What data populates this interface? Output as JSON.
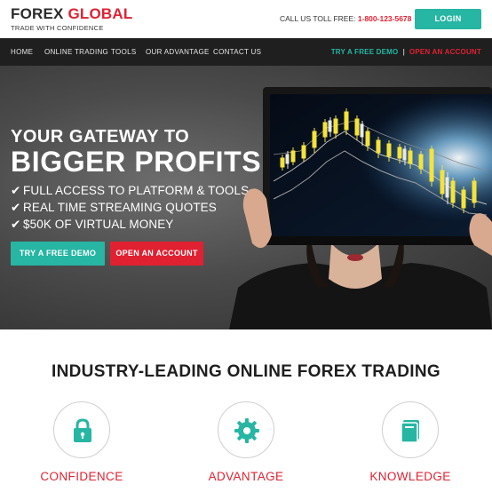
{
  "brand": {
    "name_part1": "FOREX",
    "name_part2": "GLOBAL",
    "tagline": "TRADE WITH CONFIDENCE",
    "colors": {
      "dark": "#2b2b2b",
      "red": "#e02131"
    }
  },
  "header": {
    "callus_label": "CALL US TOLL FREE:",
    "phone": "1-800-123-5678",
    "login_label": "LOGIN"
  },
  "nav": {
    "items": [
      {
        "label": "HOME"
      },
      {
        "label": "ONLINE TRADING"
      },
      {
        "label": "TOOLS"
      },
      {
        "label": "OUR ADVANTAGE"
      },
      {
        "label": "CONTACT US"
      }
    ],
    "try_demo": "TRY A FREE DEMO",
    "separator": "|",
    "open_account": "OPEN AN ACCOUNT"
  },
  "hero": {
    "title_line1": "YOUR GATEWAY TO",
    "title_line2": "BIGGER PROFITS",
    "bullets": [
      {
        "check": "✔",
        "text": "FULL ACCESS TO PLATFORM & TOOLS"
      },
      {
        "check": "✔",
        "text": "REAL TIME STREAMING QUOTES"
      },
      {
        "check": "✔",
        "text": "$50K OF VIRTUAL MONEY"
      }
    ],
    "demo_button": "TRY A FREE DEMO",
    "open_button": "OPEN AN ACCOUNT"
  },
  "features": {
    "title": "INDUSTRY-LEADING ONLINE FOREX TRADING",
    "items": [
      {
        "icon": "lock-icon",
        "label": "CONFIDENCE"
      },
      {
        "icon": "gear-icon",
        "label": "ADVANTAGE"
      },
      {
        "icon": "book-icon",
        "label": "KNOWLEDGE"
      }
    ]
  },
  "colors": {
    "accent_teal": "#26b6a3",
    "accent_red": "#e02131",
    "nav_bg": "#1f1f1f"
  }
}
